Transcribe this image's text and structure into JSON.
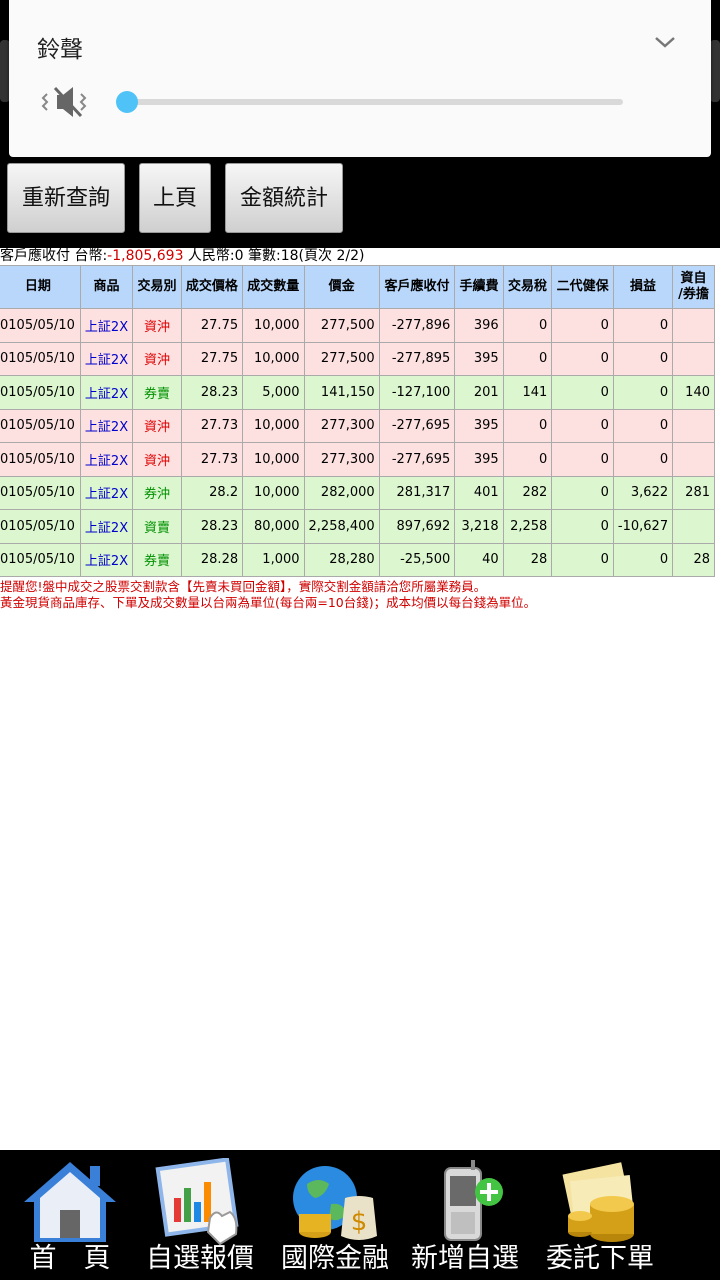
{
  "volume": {
    "title": "鈴聲",
    "level": 0
  },
  "toolbar": {
    "requery": "重新查詢",
    "prev_page": "上頁",
    "amount_stats": "金額統計"
  },
  "summary": {
    "prefix": "客戶應收付 台幣:",
    "twd_value": "-1,805,693",
    "rest": " 人民幣:0 筆數:18(頁次 2/2)"
  },
  "table": {
    "headers": [
      "日期",
      "商品",
      "交易別",
      "成交價格",
      "成交數量",
      "價金",
      "客戶應收付",
      "手續費",
      "交易稅",
      "二代健保",
      "損益",
      "資自\n/券擔"
    ],
    "rows": [
      {
        "kind": "red",
        "cells": [
          "0105/05/10",
          "上証2X",
          "資沖",
          "27.75",
          "10,000",
          "277,500",
          "-277,896",
          "396",
          "0",
          "0",
          "0",
          ""
        ]
      },
      {
        "kind": "red",
        "cells": [
          "0105/05/10",
          "上証2X",
          "資沖",
          "27.75",
          "10,000",
          "277,500",
          "-277,895",
          "395",
          "0",
          "0",
          "0",
          ""
        ]
      },
      {
        "kind": "green",
        "cells": [
          "0105/05/10",
          "上証2X",
          "券賣",
          "28.23",
          "5,000",
          "141,150",
          "-127,100",
          "201",
          "141",
          "0",
          "0",
          "140"
        ]
      },
      {
        "kind": "red",
        "cells": [
          "0105/05/10",
          "上証2X",
          "資沖",
          "27.73",
          "10,000",
          "277,300",
          "-277,695",
          "395",
          "0",
          "0",
          "0",
          ""
        ]
      },
      {
        "kind": "red",
        "cells": [
          "0105/05/10",
          "上証2X",
          "資沖",
          "27.73",
          "10,000",
          "277,300",
          "-277,695",
          "395",
          "0",
          "0",
          "0",
          ""
        ]
      },
      {
        "kind": "green",
        "cells": [
          "0105/05/10",
          "上証2X",
          "券沖",
          "28.2",
          "10,000",
          "282,000",
          "281,317",
          "401",
          "282",
          "0",
          "3,622",
          "281"
        ]
      },
      {
        "kind": "green",
        "cells": [
          "0105/05/10",
          "上証2X",
          "資賣",
          "28.23",
          "80,000",
          "2,258,400",
          "897,692",
          "3,218",
          "2,258",
          "0",
          "-10,627",
          ""
        ]
      },
      {
        "kind": "green",
        "cells": [
          "0105/05/10",
          "上証2X",
          "券賣",
          "28.28",
          "1,000",
          "28,280",
          "-25,500",
          "40",
          "28",
          "0",
          "0",
          "28"
        ]
      }
    ]
  },
  "notes": [
    "提醒您!盤中成交之股票交割款含【先賣未買回金額】，實際交割金額請洽您所屬業務員。",
    "黃金現貨商品庫存、下單及成交數量以台兩為單位(每台兩=10台錢)；成本均價以每台錢為單位。"
  ],
  "nav": [
    {
      "label": "首　頁",
      "icon": "home-icon"
    },
    {
      "label": "自選報價",
      "icon": "chart-touch-icon"
    },
    {
      "label": "國際金融",
      "icon": "globe-money-icon"
    },
    {
      "label": "新增自選",
      "icon": "phone-add-icon"
    },
    {
      "label": "委託下單",
      "icon": "coins-order-icon"
    }
  ]
}
